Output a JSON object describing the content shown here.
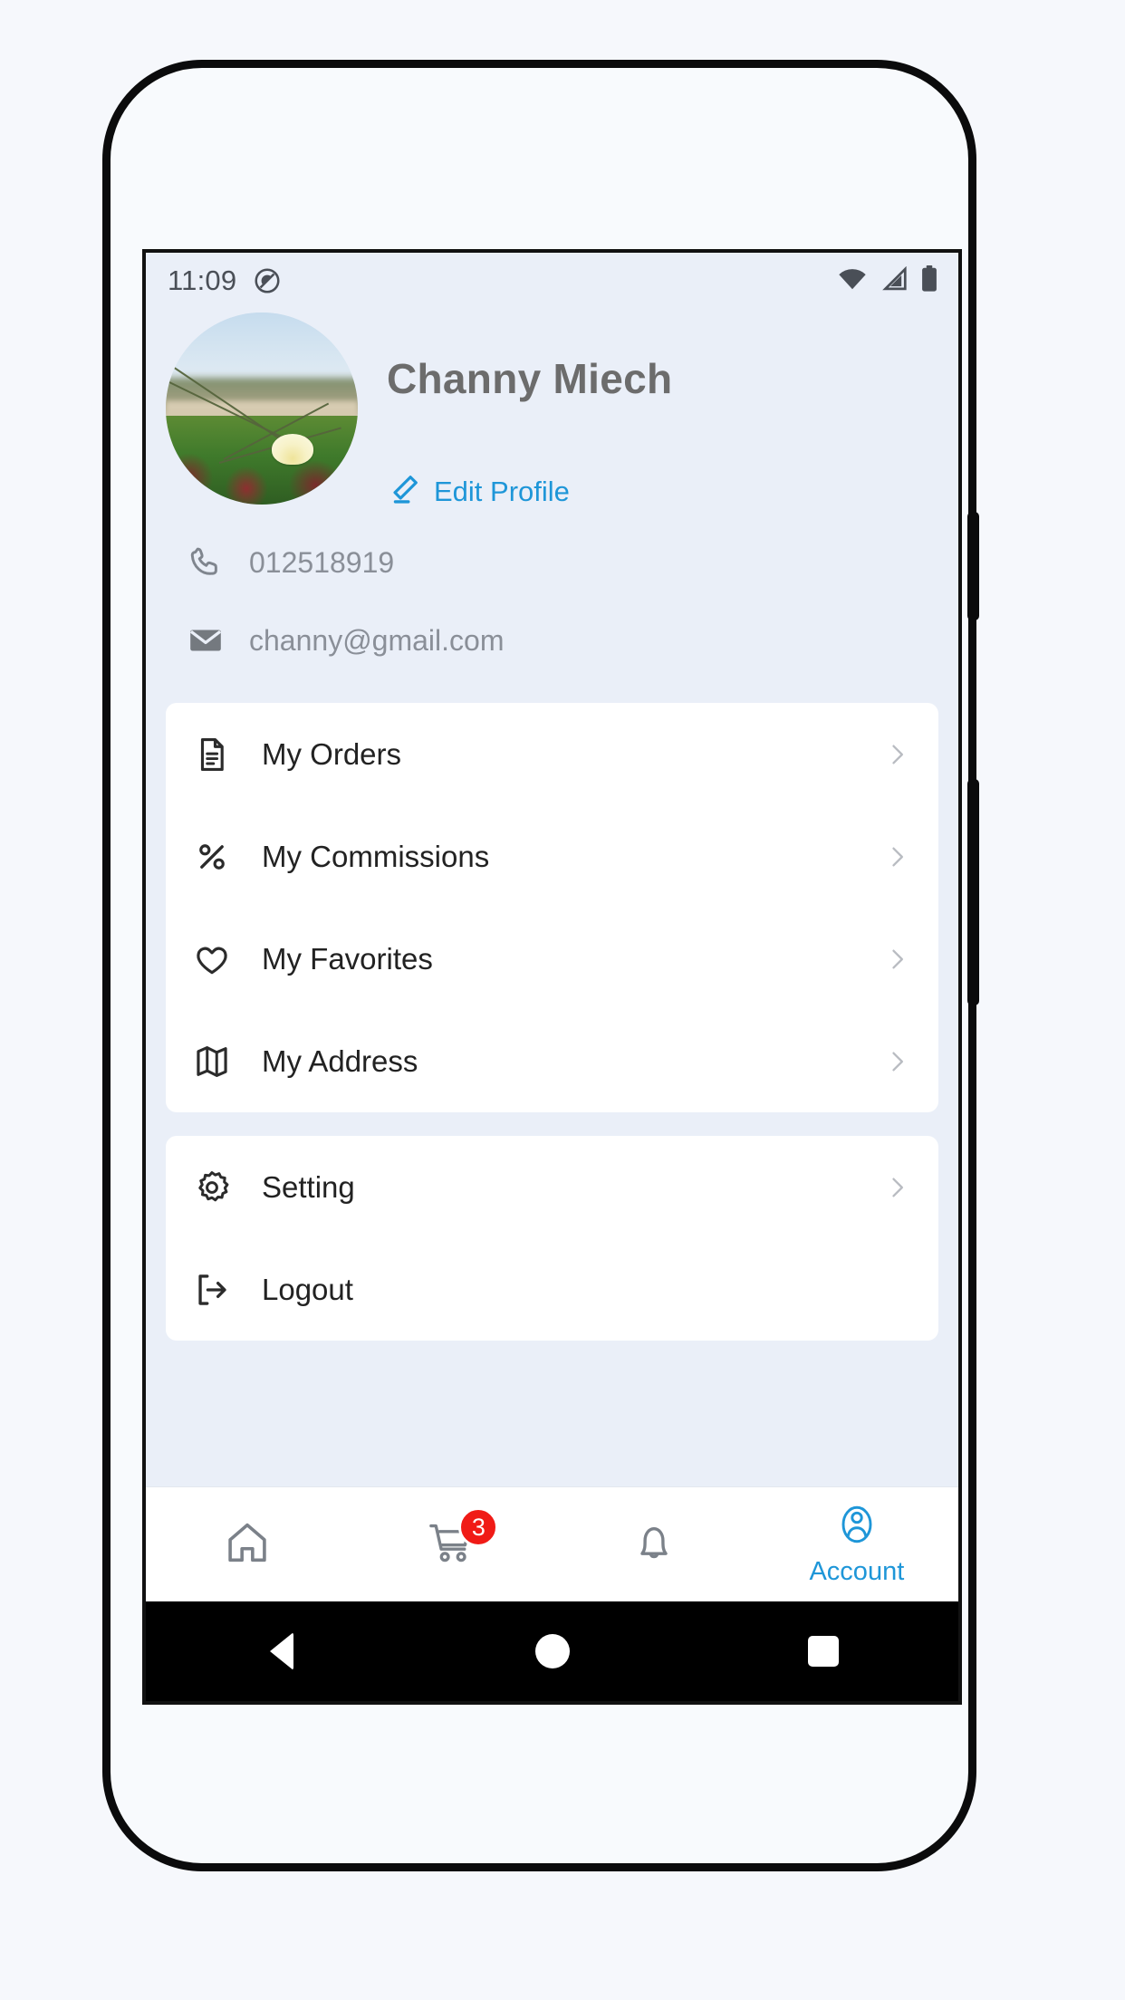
{
  "status_bar": {
    "time": "11:09",
    "icons": [
      "dnd-icon",
      "wifi-icon",
      "signal-icon",
      "battery-icon"
    ]
  },
  "profile": {
    "name": "Channy Miech",
    "avatar_alt": "nature-photo-ice-plant-flower",
    "edit_label": "Edit Profile",
    "edit_icon": "pencil-icon",
    "accent_color": "#1e96d8",
    "contacts": [
      {
        "icon": "phone-icon",
        "value": "012518919"
      },
      {
        "icon": "mail-icon",
        "value": "channy@gmail.com"
      }
    ]
  },
  "menu_cards": [
    {
      "items": [
        {
          "icon": "document-icon",
          "label": "My Orders",
          "chevron": true
        },
        {
          "icon": "percent-icon",
          "label": "My Commissions",
          "chevron": true
        },
        {
          "icon": "heart-icon",
          "label": "My Favorites",
          "chevron": true
        },
        {
          "icon": "map-icon",
          "label": "My Address",
          "chevron": true
        }
      ]
    },
    {
      "items": [
        {
          "icon": "gear-icon",
          "label": "Setting",
          "chevron": true
        },
        {
          "icon": "logout-icon",
          "label": "Logout",
          "chevron": false
        }
      ]
    }
  ],
  "bottom_nav": {
    "active_color": "#1e96d8",
    "badge_color": "#f01b16",
    "items": [
      {
        "icon": "home-icon",
        "label": "",
        "active": false,
        "badge": ""
      },
      {
        "icon": "cart-icon",
        "label": "",
        "active": false,
        "badge": "3"
      },
      {
        "icon": "bell-icon",
        "label": "",
        "active": false,
        "badge": ""
      },
      {
        "icon": "account-icon",
        "label": "Account",
        "active": true,
        "badge": ""
      }
    ]
  },
  "android_nav": {
    "items": [
      "back-button",
      "home-button",
      "recents-button"
    ]
  }
}
